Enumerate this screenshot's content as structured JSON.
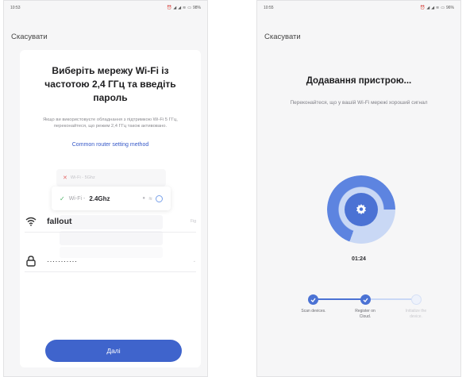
{
  "colors": {
    "accent": "#3f64cc",
    "accent_light": "#c9d8f5",
    "success": "#4fb36a",
    "error": "#e46b6b",
    "link": "#3558c8"
  },
  "left_screen": {
    "status_bar": {
      "time": "10:53",
      "battery": "98%",
      "icons": [
        "alarm-icon",
        "signal-icon",
        "signal-icon",
        "wifi-icon",
        "battery-icon"
      ]
    },
    "cancel_label": "Скасувати",
    "title": "Виберіть мережу Wi-Fi із частотою 2,4 ГГц та введіть пароль",
    "hint": "Якщо ви використовуєте обладнання з підтримкою Wi-Fi 5 ГГц, переконайтеся, що режим 2,4 ГГц також активовано.",
    "router_link": "Common router setting method",
    "illustration": {
      "row_bad_label": "Wi-Fi - 5Ghz",
      "row_good_prefix": "Wi-Fi - ",
      "row_good_band": "2.4Ghz"
    },
    "ssid": {
      "value": "fallout",
      "trailing": "Fig"
    },
    "password": {
      "value": "···········"
    },
    "next_button": "Далі"
  },
  "right_screen": {
    "status_bar": {
      "time": "10:55",
      "battery": "96%",
      "icons": [
        "alarm-icon",
        "signal-icon",
        "signal-icon",
        "wifi-icon",
        "battery-icon"
      ]
    },
    "cancel_label": "Скасувати",
    "title": "Додавання пристрою...",
    "subtitle": "Переконайтеся, що у вашій Wi-Fi мережі хороший сигнал",
    "timer": "01:24",
    "progress": 0.7,
    "steps": [
      {
        "label": "Scan devices.",
        "state": "done"
      },
      {
        "label": "Register on Cloud.",
        "state": "done"
      },
      {
        "label": "Initialize the device.",
        "state": "pending"
      }
    ]
  }
}
